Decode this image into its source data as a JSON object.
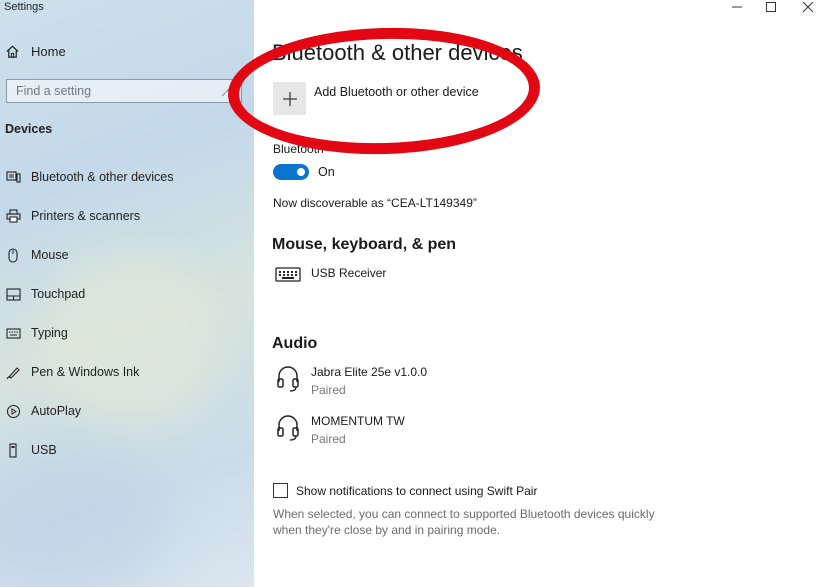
{
  "window": {
    "title": "Settings",
    "minimize_icon": "minimize-icon",
    "maximize_icon": "maximize-icon",
    "close_icon": "close-icon"
  },
  "sidebar": {
    "home_label": "Home",
    "search_placeholder": "Find a setting",
    "section_title": "Devices",
    "items": [
      {
        "label": "Bluetooth & other devices",
        "icon": "bluetooth-devices-icon"
      },
      {
        "label": "Printers & scanners",
        "icon": "printer-icon"
      },
      {
        "label": "Mouse",
        "icon": "mouse-icon"
      },
      {
        "label": "Touchpad",
        "icon": "touchpad-icon"
      },
      {
        "label": "Typing",
        "icon": "keyboard-icon"
      },
      {
        "label": "Pen & Windows Ink",
        "icon": "pen-icon"
      },
      {
        "label": "AutoPlay",
        "icon": "autoplay-icon"
      },
      {
        "label": "USB",
        "icon": "usb-icon"
      }
    ]
  },
  "main": {
    "title": "Bluetooth & other devices",
    "add_device_label": "Add Bluetooth or other device",
    "bluetooth_label": "Bluetooth",
    "bluetooth_state": "On",
    "discoverable_text": "Now discoverable as “CEA-LT149349”",
    "mouse_section": {
      "title": "Mouse, keyboard, & pen",
      "devices": [
        {
          "name": "USB Receiver",
          "status": "",
          "icon": "keyboard-icon"
        }
      ]
    },
    "audio_section": {
      "title": "Audio",
      "devices": [
        {
          "name": "Jabra Elite 25e v1.0.0",
          "status": "Paired",
          "icon": "headphones-icon"
        },
        {
          "name": "MOMENTUM TW",
          "status": "Paired",
          "icon": "headphones-icon"
        }
      ]
    },
    "swift_pair_label": "Show notifications to connect using Swift Pair",
    "swift_pair_help": "When selected, you can connect to supported Bluetooth devices quickly when they're close by and in pairing mode.",
    "swift_pair_checked": false
  },
  "colors": {
    "accent": "#0a74d0",
    "annotation": "#e30613"
  }
}
